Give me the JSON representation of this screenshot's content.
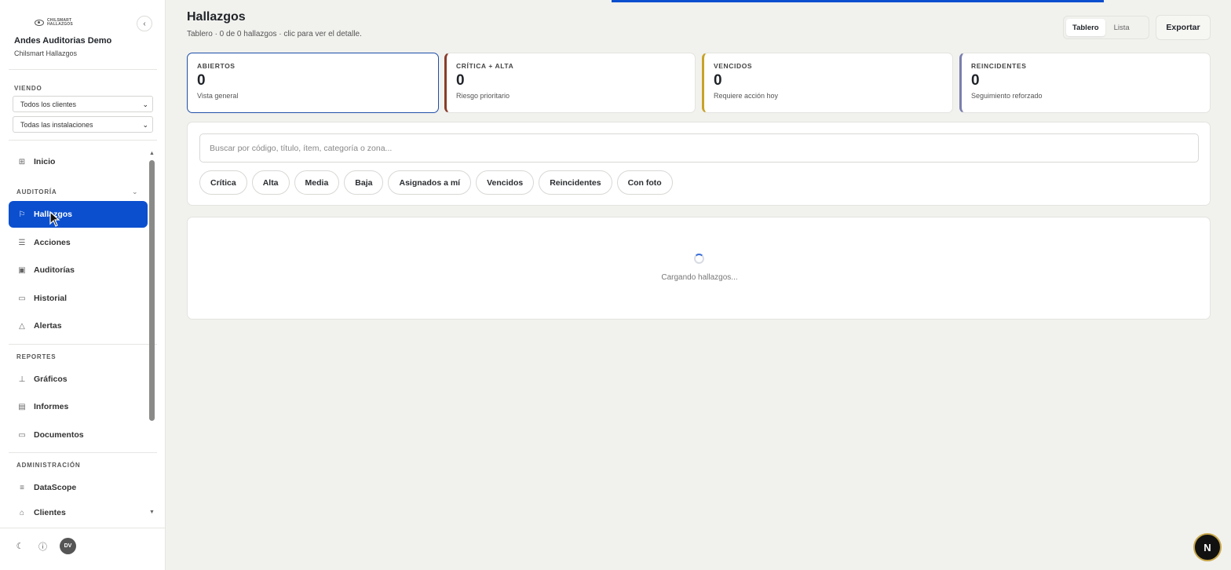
{
  "sidebar": {
    "brand_line1": "CHILSMART",
    "brand_line2": "HALLAZGOS",
    "collapse_icon": "chevron-left-icon",
    "org_name": "Andes Auditorias Demo",
    "org_sub": "Chilsmart Hallazgos",
    "viewing_label": "VIENDO",
    "client_select": "Todos los clientes",
    "installation_select": "Todas las instalaciones",
    "home_label": "Inicio",
    "groups": {
      "auditoria": "AUDITORÍA",
      "reportes": "REPORTES",
      "administracion": "ADMINISTRACIÓN"
    },
    "items": {
      "hallazgos": "Hallazgos",
      "acciones": "Acciones",
      "auditorias": "Auditorías",
      "historial": "Historial",
      "alertas": "Alertas",
      "graficos": "Gráficos",
      "informes": "Informes",
      "documentos": "Documentos",
      "datascope": "DataScope",
      "clientes": "Clientes"
    },
    "avatar_initials": "DV"
  },
  "header": {
    "title": "Hallazgos",
    "subtitle": "Tablero · 0 de 0 hallazgos · clic para ver el detalle.",
    "view_board": "Tablero",
    "view_list": "Lista",
    "export": "Exportar"
  },
  "stats": [
    {
      "label": "ABIERTOS",
      "value": "0",
      "sub": "Vista general",
      "color": "#1f4fa8"
    },
    {
      "label": "CRÍTICA + ALTA",
      "value": "0",
      "sub": "Riesgo prioritario",
      "color": "#8a3b2a"
    },
    {
      "label": "VENCIDOS",
      "value": "0",
      "sub": "Requiere acción hoy",
      "color": "#c9a227"
    },
    {
      "label": "REINCIDENTES",
      "value": "0",
      "sub": "Seguimiento reforzado",
      "color": "#7a7fae"
    }
  ],
  "filters": {
    "search_placeholder": "Buscar por código, título, ítem, categoría o zona...",
    "chips": [
      "Crítica",
      "Alta",
      "Media",
      "Baja",
      "Asignados a mí",
      "Vencidos",
      "Reincidentes",
      "Con foto"
    ]
  },
  "results": {
    "loading": "Cargando hallazgos..."
  },
  "badge_letter": "N",
  "colors": {
    "accent": "#0b4fcf"
  }
}
